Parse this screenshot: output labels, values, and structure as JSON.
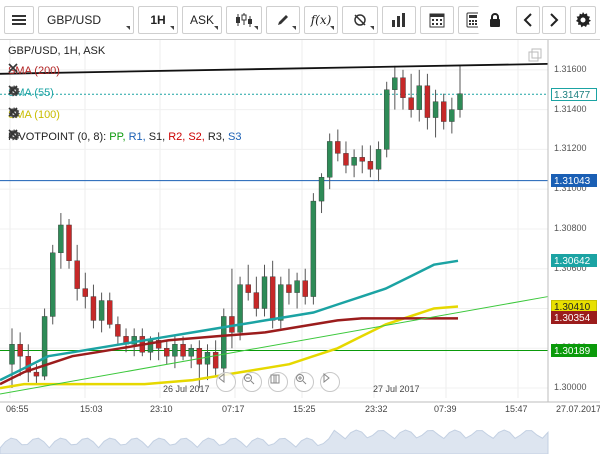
{
  "toolbar": {
    "symbol": "GBP/USD",
    "timeframe": "1H",
    "price_type": "ASK",
    "fx_label": "f(x)"
  },
  "legend": {
    "title": "GBP/USD, 1H, ASK",
    "sma200": "SMA (200)",
    "sma55": "SMA (55)",
    "sma100": "SMA (100)",
    "pivot_prefix": "PIVOTPOINT (0, 8): ",
    "pp": "PP,",
    "r1": "R1,",
    "s1": "S1,",
    "r2": "R2,",
    "s2": "S2,",
    "r3": "R3,",
    "s3": "S3",
    "colors": {
      "sma200": "#b22222",
      "sma55": "#1ba3a3",
      "sma100": "#d4c800",
      "pp": "#0a9a0a",
      "r1": "#1a5fb4",
      "s1": "#222222",
      "r2": "#cc0000",
      "s2": "#cc0000",
      "r3": "#222222",
      "s3": "#1a5fb4"
    }
  },
  "price_axis": {
    "ticks": [
      "1.31600",
      "1.31400",
      "1.31200",
      "1.31000",
      "1.30800",
      "1.30600",
      "1.30400",
      "1.30200",
      "1.30000"
    ],
    "tags": [
      {
        "label": "1.31477",
        "value": 1.31477,
        "bg": "#ffffff",
        "fg": "#1a7f7f",
        "border": "#1ba3a3"
      },
      {
        "label": "1.31043",
        "value": 1.31043,
        "bg": "#1a5fb4",
        "fg": "#ffffff",
        "border": "#1a5fb4"
      },
      {
        "label": "1.30642",
        "value": 1.30642,
        "bg": "#1ba3a3",
        "fg": "#ffffff",
        "border": "#1ba3a3"
      },
      {
        "label": "1.30410",
        "value": 1.3041,
        "bg": "#e8e000",
        "fg": "#222222",
        "border": "#c8c000"
      },
      {
        "label": "1.30354",
        "value": 1.30354,
        "bg": "#9b1c1c",
        "fg": "#ffffff",
        "border": "#9b1c1c"
      },
      {
        "label": "1.30189",
        "value": 1.30189,
        "bg": "#0a9a0a",
        "fg": "#ffffff",
        "border": "#0a9a0a"
      }
    ]
  },
  "time_axis": {
    "labels": [
      "06:55",
      "15:03",
      "23:10",
      "07:17",
      "15:25",
      "23:32",
      "07:39",
      "15:47",
      "27.07.2017"
    ],
    "dates": [
      "26 Jul 2017",
      "27 Jul 2017"
    ]
  },
  "chart_data": {
    "type": "candlestick",
    "ylim": [
      1.2995,
      1.3175
    ],
    "candles": [
      {
        "o": 1.3012,
        "h": 1.303,
        "l": 1.3,
        "c": 1.3022
      },
      {
        "o": 1.3022,
        "h": 1.3028,
        "l": 1.3006,
        "c": 1.3016
      },
      {
        "o": 1.3016,
        "h": 1.3022,
        "l": 1.3003,
        "c": 1.3008
      },
      {
        "o": 1.3008,
        "h": 1.3012,
        "l": 1.3002,
        "c": 1.3006
      },
      {
        "o": 1.3006,
        "h": 1.304,
        "l": 1.3004,
        "c": 1.3036
      },
      {
        "o": 1.3036,
        "h": 1.3072,
        "l": 1.3032,
        "c": 1.3068
      },
      {
        "o": 1.3068,
        "h": 1.3088,
        "l": 1.306,
        "c": 1.3082
      },
      {
        "o": 1.3082,
        "h": 1.3085,
        "l": 1.306,
        "c": 1.3064
      },
      {
        "o": 1.3064,
        "h": 1.3072,
        "l": 1.3044,
        "c": 1.305
      },
      {
        "o": 1.305,
        "h": 1.3058,
        "l": 1.304,
        "c": 1.3046
      },
      {
        "o": 1.3046,
        "h": 1.3052,
        "l": 1.303,
        "c": 1.3034
      },
      {
        "o": 1.3034,
        "h": 1.3048,
        "l": 1.3028,
        "c": 1.3044
      },
      {
        "o": 1.3044,
        "h": 1.3048,
        "l": 1.303,
        "c": 1.3032
      },
      {
        "o": 1.3032,
        "h": 1.3036,
        "l": 1.3022,
        "c": 1.3026
      },
      {
        "o": 1.3026,
        "h": 1.303,
        "l": 1.3018,
        "c": 1.3022
      },
      {
        "o": 1.3022,
        "h": 1.303,
        "l": 1.3016,
        "c": 1.3026
      },
      {
        "o": 1.3026,
        "h": 1.303,
        "l": 1.3016,
        "c": 1.3018
      },
      {
        "o": 1.3018,
        "h": 1.3026,
        "l": 1.3014,
        "c": 1.3024
      },
      {
        "o": 1.3024,
        "h": 1.3028,
        "l": 1.3014,
        "c": 1.302
      },
      {
        "o": 1.302,
        "h": 1.3024,
        "l": 1.3012,
        "c": 1.3016
      },
      {
        "o": 1.3016,
        "h": 1.3026,
        "l": 1.301,
        "c": 1.3022
      },
      {
        "o": 1.3022,
        "h": 1.3026,
        "l": 1.3014,
        "c": 1.3016
      },
      {
        "o": 1.3016,
        "h": 1.3022,
        "l": 1.301,
        "c": 1.302
      },
      {
        "o": 1.302,
        "h": 1.3024,
        "l": 1.3,
        "c": 1.3012
      },
      {
        "o": 1.3012,
        "h": 1.3022,
        "l": 1.3004,
        "c": 1.3018
      },
      {
        "o": 1.3018,
        "h": 1.3024,
        "l": 1.3006,
        "c": 1.301
      },
      {
        "o": 1.301,
        "h": 1.304,
        "l": 1.3006,
        "c": 1.3036
      },
      {
        "o": 1.3036,
        "h": 1.306,
        "l": 1.302,
        "c": 1.3028
      },
      {
        "o": 1.3028,
        "h": 1.3056,
        "l": 1.3024,
        "c": 1.3052
      },
      {
        "o": 1.3052,
        "h": 1.3062,
        "l": 1.3044,
        "c": 1.3048
      },
      {
        "o": 1.3048,
        "h": 1.3056,
        "l": 1.3036,
        "c": 1.304
      },
      {
        "o": 1.304,
        "h": 1.3062,
        "l": 1.3036,
        "c": 1.3056
      },
      {
        "o": 1.3056,
        "h": 1.3064,
        "l": 1.303,
        "c": 1.3034
      },
      {
        "o": 1.3034,
        "h": 1.3056,
        "l": 1.303,
        "c": 1.3052
      },
      {
        "o": 1.3052,
        "h": 1.306,
        "l": 1.3042,
        "c": 1.3048
      },
      {
        "o": 1.3048,
        "h": 1.3058,
        "l": 1.304,
        "c": 1.3054
      },
      {
        "o": 1.3054,
        "h": 1.306,
        "l": 1.3042,
        "c": 1.3046
      },
      {
        "o": 1.3046,
        "h": 1.3098,
        "l": 1.3042,
        "c": 1.3094
      },
      {
        "o": 1.3094,
        "h": 1.3108,
        "l": 1.3088,
        "c": 1.3106
      },
      {
        "o": 1.3106,
        "h": 1.3128,
        "l": 1.31,
        "c": 1.3124
      },
      {
        "o": 1.3124,
        "h": 1.313,
        "l": 1.3114,
        "c": 1.3118
      },
      {
        "o": 1.3118,
        "h": 1.3124,
        "l": 1.3108,
        "c": 1.3112
      },
      {
        "o": 1.3112,
        "h": 1.312,
        "l": 1.3106,
        "c": 1.3116
      },
      {
        "o": 1.3116,
        "h": 1.3122,
        "l": 1.3108,
        "c": 1.3114
      },
      {
        "o": 1.3114,
        "h": 1.3122,
        "l": 1.3106,
        "c": 1.311
      },
      {
        "o": 1.311,
        "h": 1.3124,
        "l": 1.3104,
        "c": 1.312
      },
      {
        "o": 1.312,
        "h": 1.3154,
        "l": 1.3116,
        "c": 1.315
      },
      {
        "o": 1.315,
        "h": 1.3162,
        "l": 1.314,
        "c": 1.3156
      },
      {
        "o": 1.3156,
        "h": 1.316,
        "l": 1.314,
        "c": 1.3146
      },
      {
        "o": 1.3146,
        "h": 1.3158,
        "l": 1.3136,
        "c": 1.314
      },
      {
        "o": 1.314,
        "h": 1.316,
        "l": 1.3134,
        "c": 1.3152
      },
      {
        "o": 1.3152,
        "h": 1.3158,
        "l": 1.313,
        "c": 1.3136
      },
      {
        "o": 1.3136,
        "h": 1.315,
        "l": 1.3126,
        "c": 1.3144
      },
      {
        "o": 1.3144,
        "h": 1.3148,
        "l": 1.313,
        "c": 1.3134
      },
      {
        "o": 1.3134,
        "h": 1.3146,
        "l": 1.3128,
        "c": 1.314
      },
      {
        "o": 1.314,
        "h": 1.3162,
        "l": 1.3136,
        "c": 1.3148
      }
    ],
    "sma55": [
      1.3004,
      1.301,
      1.3016,
      1.3018,
      1.302,
      1.3022,
      1.3024,
      1.3026,
      1.3028,
      1.303,
      1.3032,
      1.3034,
      1.3036,
      1.3038,
      1.3042,
      1.3046,
      1.305,
      1.3056,
      1.3062,
      1.3064
    ],
    "sma200": [
      1.3002,
      1.3008,
      1.3012,
      1.3016,
      1.3018,
      1.302,
      1.3022,
      1.3024,
      1.3025,
      1.3026,
      1.3027,
      1.3028,
      1.303,
      1.3032,
      1.3034,
      1.3035,
      1.3035,
      1.3035,
      1.3035,
      1.3035
    ],
    "sma100": [
      1.3,
      1.3002,
      1.3002,
      1.3002,
      1.3002,
      1.3002,
      1.3002,
      1.3003,
      1.3004,
      1.3006,
      1.3008,
      1.301,
      1.3012,
      1.3016,
      1.302,
      1.3026,
      1.3032,
      1.3036,
      1.304,
      1.3041
    ],
    "pivot_green": [
      1.2997,
      1.3046
    ],
    "black_trendline": [
      1.3158,
      1.3163
    ],
    "hlines": [
      1.31043,
      1.30189
    ],
    "last_price": 1.31477
  }
}
